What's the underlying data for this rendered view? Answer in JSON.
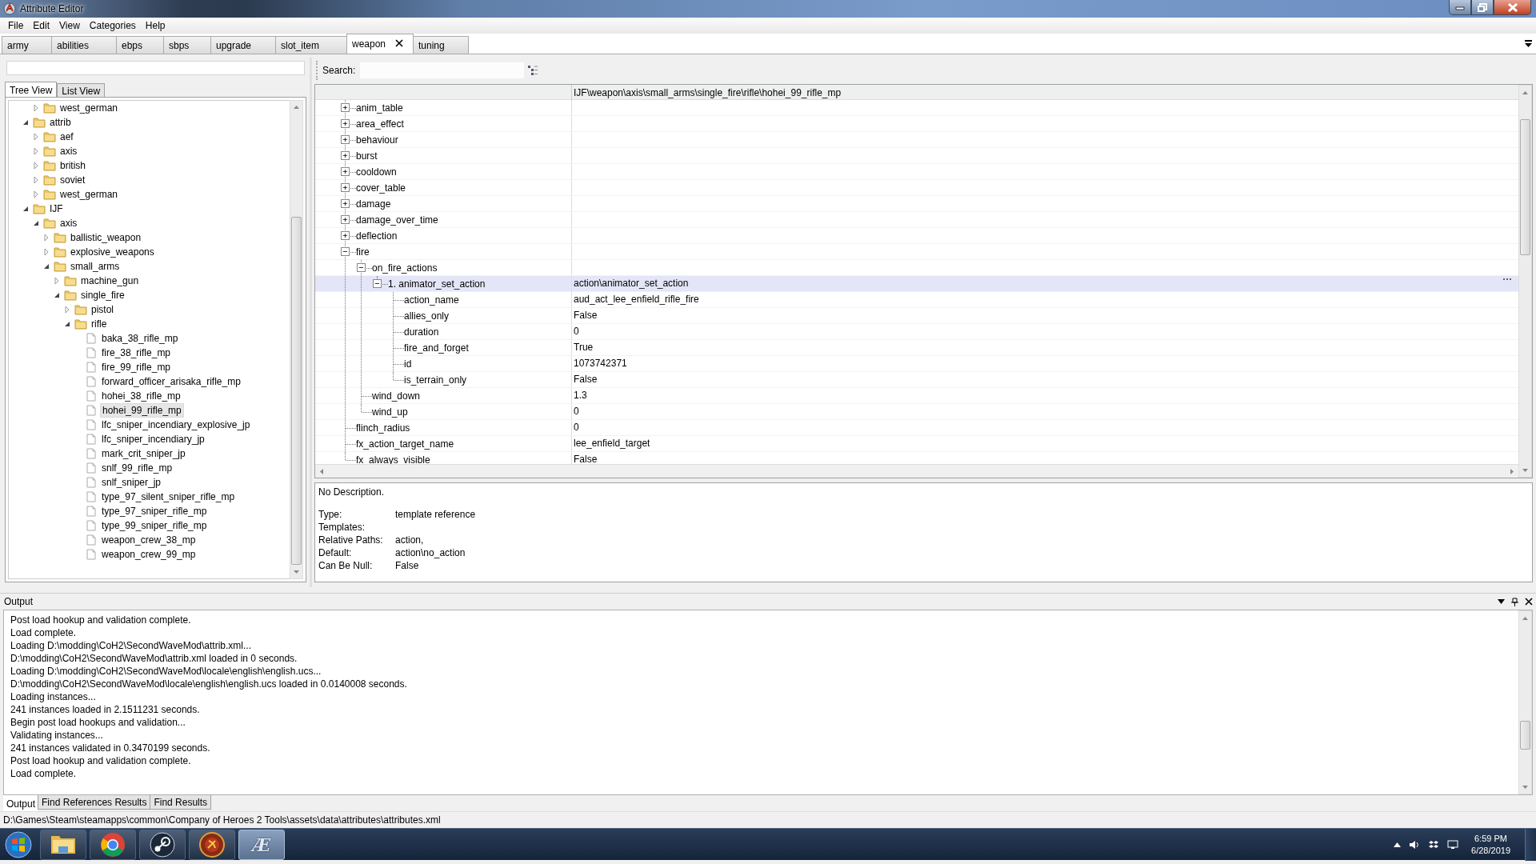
{
  "window": {
    "title": "Attribute Editor"
  },
  "menu": [
    "File",
    "Edit",
    "View",
    "Categories",
    "Help"
  ],
  "tabs": [
    {
      "label": "army",
      "selected": false
    },
    {
      "label": "abilities",
      "selected": false
    },
    {
      "label": "ebps",
      "selected": false
    },
    {
      "label": "sbps",
      "selected": false
    },
    {
      "label": "upgrade",
      "selected": false
    },
    {
      "label": "slot_item",
      "selected": false
    },
    {
      "label": "weapon",
      "selected": true
    },
    {
      "label": "tuning",
      "selected": false
    }
  ],
  "left_panel": {
    "view_tabs": [
      {
        "label": "Tree View",
        "selected": true
      },
      {
        "label": "List View",
        "selected": false
      }
    ],
    "tree": [
      {
        "children": [
          {
            "label": "west_german",
            "kind": "folder",
            "expanded": false,
            "selected": false
          }
        ]
      },
      {
        "label": "attrib",
        "kind": "folder",
        "expanded": true,
        "selected": false,
        "children": [
          {
            "label": "aef",
            "kind": "folder",
            "expanded": false,
            "selected": false
          },
          {
            "label": "axis",
            "kind": "folder",
            "expanded": false,
            "selected": false
          },
          {
            "label": "british",
            "kind": "folder",
            "expanded": false,
            "selected": false
          },
          {
            "label": "soviet",
            "kind": "folder",
            "expanded": false,
            "selected": false
          },
          {
            "label": "west_german",
            "kind": "folder",
            "expanded": false,
            "selected": false
          }
        ]
      },
      {
        "label": "IJF",
        "kind": "folder",
        "expanded": true,
        "selected": false,
        "children": [
          {
            "label": "axis",
            "kind": "folder",
            "expanded": true,
            "selected": false,
            "children": [
              {
                "label": "ballistic_weapon",
                "kind": "folder",
                "expanded": false,
                "selected": false
              },
              {
                "label": "explosive_weapons",
                "kind": "folder",
                "expanded": false,
                "selected": false
              },
              {
                "label": "small_arms",
                "kind": "folder",
                "expanded": true,
                "selected": false,
                "children": [
                  {
                    "label": "machine_gun",
                    "kind": "folder",
                    "expanded": false,
                    "selected": false
                  },
                  {
                    "label": "single_fire",
                    "kind": "folder",
                    "expanded": true,
                    "selected": false,
                    "children": [
                      {
                        "label": "pistol",
                        "kind": "folder",
                        "expanded": false,
                        "selected": false
                      },
                      {
                        "label": "rifle",
                        "kind": "folder",
                        "expanded": true,
                        "selected": false,
                        "children": [
                          {
                            "label": "baka_38_rifle_mp",
                            "kind": "file",
                            "selected": false
                          },
                          {
                            "label": "fire_38_rifle_mp",
                            "kind": "file",
                            "selected": false
                          },
                          {
                            "label": "fire_99_rifle_mp",
                            "kind": "file",
                            "selected": false
                          },
                          {
                            "label": "forward_officer_arisaka_rifle_mp",
                            "kind": "file",
                            "selected": false
                          },
                          {
                            "label": "hohei_38_rifle_mp",
                            "kind": "file",
                            "selected": false
                          },
                          {
                            "label": "hohei_99_rifle_mp",
                            "kind": "file",
                            "selected": true
                          },
                          {
                            "label": "lfc_sniper_incendiary_explosive_jp",
                            "kind": "file",
                            "selected": false
                          },
                          {
                            "label": "lfc_sniper_incendiary_jp",
                            "kind": "file",
                            "selected": false
                          },
                          {
                            "label": "mark_crit_sniper_jp",
                            "kind": "file",
                            "selected": false
                          },
                          {
                            "label": "snlf_99_rifle_mp",
                            "kind": "file",
                            "selected": false
                          },
                          {
                            "label": "snlf_sniper_jp",
                            "kind": "file",
                            "selected": false
                          },
                          {
                            "label": "type_97_silent_sniper_rifle_mp",
                            "kind": "file",
                            "selected": false
                          },
                          {
                            "label": "type_97_sniper_rifle_mp",
                            "kind": "file",
                            "selected": false
                          },
                          {
                            "label": "type_99_sniper_rifle_mp",
                            "kind": "file",
                            "selected": false
                          },
                          {
                            "label": "weapon_crew_38_mp",
                            "kind": "file",
                            "selected": false
                          },
                          {
                            "label": "weapon_crew_99_mp",
                            "kind": "file",
                            "selected": false
                          }
                        ]
                      }
                    ]
                  }
                ]
              }
            ]
          }
        ]
      }
    ]
  },
  "property_grid": {
    "search_label": "Search:",
    "path": "IJF\\weapon\\axis\\small_arms\\single_fire\\rifle\\hohei_99_rifle_mp",
    "rows": [
      {
        "name": "anim_table",
        "expanded": false,
        "selected": false
      },
      {
        "name": "area_effect",
        "expanded": false,
        "selected": false
      },
      {
        "name": "behaviour",
        "expanded": false,
        "selected": false
      },
      {
        "name": "burst",
        "expanded": false,
        "selected": false
      },
      {
        "name": "cooldown",
        "expanded": false,
        "selected": false
      },
      {
        "name": "cover_table",
        "expanded": false,
        "selected": false
      },
      {
        "name": "damage",
        "expanded": false,
        "selected": false
      },
      {
        "name": "damage_over_time",
        "expanded": false,
        "selected": false
      },
      {
        "name": "deflection",
        "expanded": false,
        "selected": false
      },
      {
        "name": "fire",
        "expanded": true,
        "selected": false,
        "children": [
          {
            "name": "on_fire_actions",
            "expanded": true,
            "selected": false,
            "children": [
              {
                "name": "1. animator_set_action",
                "value": "action\\animator_set_action",
                "expanded": true,
                "selected": true,
                "children": [
                  {
                    "name": "action_name",
                    "value": "aud_act_lee_enfield_rifle_fire",
                    "selected": false
                  },
                  {
                    "name": "allies_only",
                    "value": "False",
                    "selected": false
                  },
                  {
                    "name": "duration",
                    "value": "0",
                    "selected": false
                  },
                  {
                    "name": "fire_and_forget",
                    "value": "True",
                    "selected": false
                  },
                  {
                    "name": "id",
                    "value": "1073742371",
                    "selected": false
                  },
                  {
                    "name": "is_terrain_only",
                    "value": "False",
                    "selected": false
                  }
                ]
              }
            ]
          },
          {
            "name": "wind_down",
            "value": "1.3",
            "selected": false
          },
          {
            "name": "wind_up",
            "value": "0",
            "selected": false
          }
        ]
      },
      {
        "name": "flinch_radius",
        "value": "0",
        "selected": false
      },
      {
        "name": "fx_action_target_name",
        "value": "lee_enfield_target",
        "selected": false
      },
      {
        "name": "fx_always_visible",
        "value": "False",
        "selected": false
      }
    ]
  },
  "description": {
    "text": "No Description.",
    "fields": [
      {
        "label": "Type:",
        "value": "template reference"
      },
      {
        "label": "Templates:"
      },
      {
        "label": "Relative Paths:",
        "value": "action,"
      },
      {
        "label": "Default:",
        "value": "action\\no_action"
      },
      {
        "label": "Can Be Null:",
        "value": "False"
      }
    ]
  },
  "output": {
    "title": "Output",
    "lines": [
      "Post load hookup and validation complete.",
      "Load complete.",
      "Loading D:\\modding\\CoH2\\SecondWaveMod\\attrib.xml...",
      "D:\\modding\\CoH2\\SecondWaveMod\\attrib.xml loaded in 0 seconds.",
      "Loading D:\\modding\\CoH2\\SecondWaveMod\\locale\\english\\english.ucs...",
      "D:\\modding\\CoH2\\SecondWaveMod\\locale\\english\\english.ucs loaded in 0.0140008 seconds.",
      "Loading instances...",
      "241 instances loaded in 2.1511231 seconds.",
      "Begin post load hookups and validation...",
      "Validating instances...",
      "241 instances validated in 0.3470199 seconds.",
      "Post load hookup and validation complete.",
      "Load complete."
    ],
    "tabs": [
      {
        "label": "Output",
        "selected": true
      },
      {
        "label": "Find References Results",
        "selected": false
      },
      {
        "label": "Find Results",
        "selected": false
      }
    ]
  },
  "status_bar": "D:\\Games\\Steam\\steamapps\\common\\Company of Heroes 2 Tools\\assets\\data\\attributes\\attributes.xml",
  "taskbar": {
    "apps": [
      {
        "kind": "folder",
        "selected": false
      },
      {
        "kind": "browser",
        "selected": false
      },
      {
        "kind": "steam",
        "selected": false
      },
      {
        "kind": "emblem",
        "selected": false
      },
      {
        "kind": "editor",
        "logo_text": "Æ",
        "selected": true
      }
    ],
    "time": "6:59 PM",
    "date": "6/28/2019"
  }
}
